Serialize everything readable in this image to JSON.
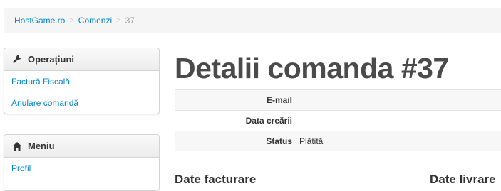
{
  "breadcrumb": {
    "items": [
      "HostGame.ro",
      "Comenzi"
    ],
    "current": "37",
    "separator": ">"
  },
  "operations_panel": {
    "title": "Operațiuni",
    "icon": "wrench-icon",
    "items": [
      "Factură Fiscală",
      "Anulare comandă"
    ]
  },
  "menu_panel": {
    "title": "Meniu",
    "icon": "home-icon",
    "items": [
      "Profil"
    ]
  },
  "main": {
    "title": "Detalii comanda #37",
    "details": [
      {
        "label": "E-mail",
        "value": ""
      },
      {
        "label": "Data creării",
        "value": ""
      },
      {
        "label": "Status",
        "value": "Plătită"
      }
    ],
    "billing_heading": "Date facturare",
    "delivery_heading": "Date livrare"
  },
  "colors": {
    "link": "#0088cc",
    "breadcrumb_bg": "#f5f5f5"
  }
}
